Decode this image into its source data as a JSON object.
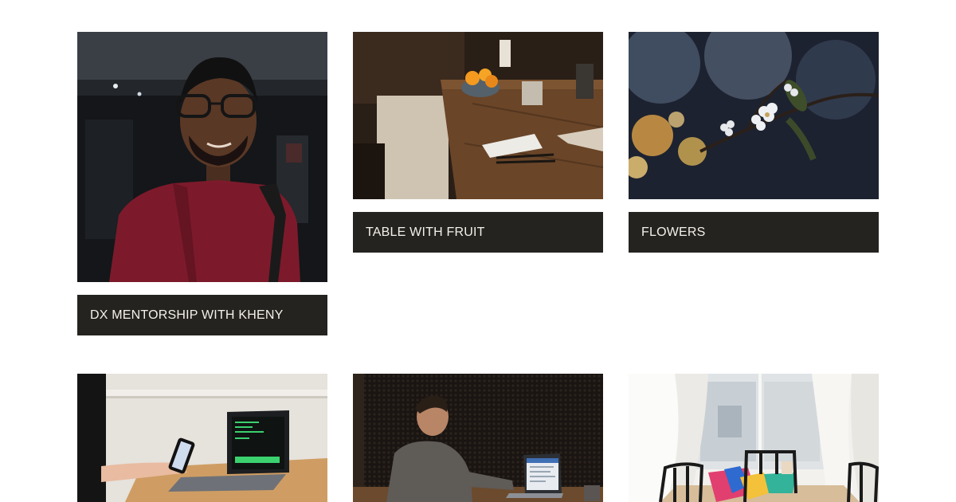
{
  "gallery": {
    "items": [
      {
        "caption": "DX MENTORSHIP WITH KHENY",
        "image_subject": "portrait-photo"
      },
      {
        "caption": "TABLE WITH FRUIT",
        "image_subject": "table-photo"
      },
      {
        "caption": "FLOWERS",
        "image_subject": "flowers-photo"
      },
      {
        "caption": "",
        "image_subject": "laptop-phone-photo"
      },
      {
        "caption": "",
        "image_subject": "man-laptop-photo"
      },
      {
        "caption": "",
        "image_subject": "dining-room-photo"
      }
    ]
  },
  "colors": {
    "caption_bg": "#25231f",
    "caption_text": "#f4f1ea",
    "page_bg": "#ffffff"
  }
}
